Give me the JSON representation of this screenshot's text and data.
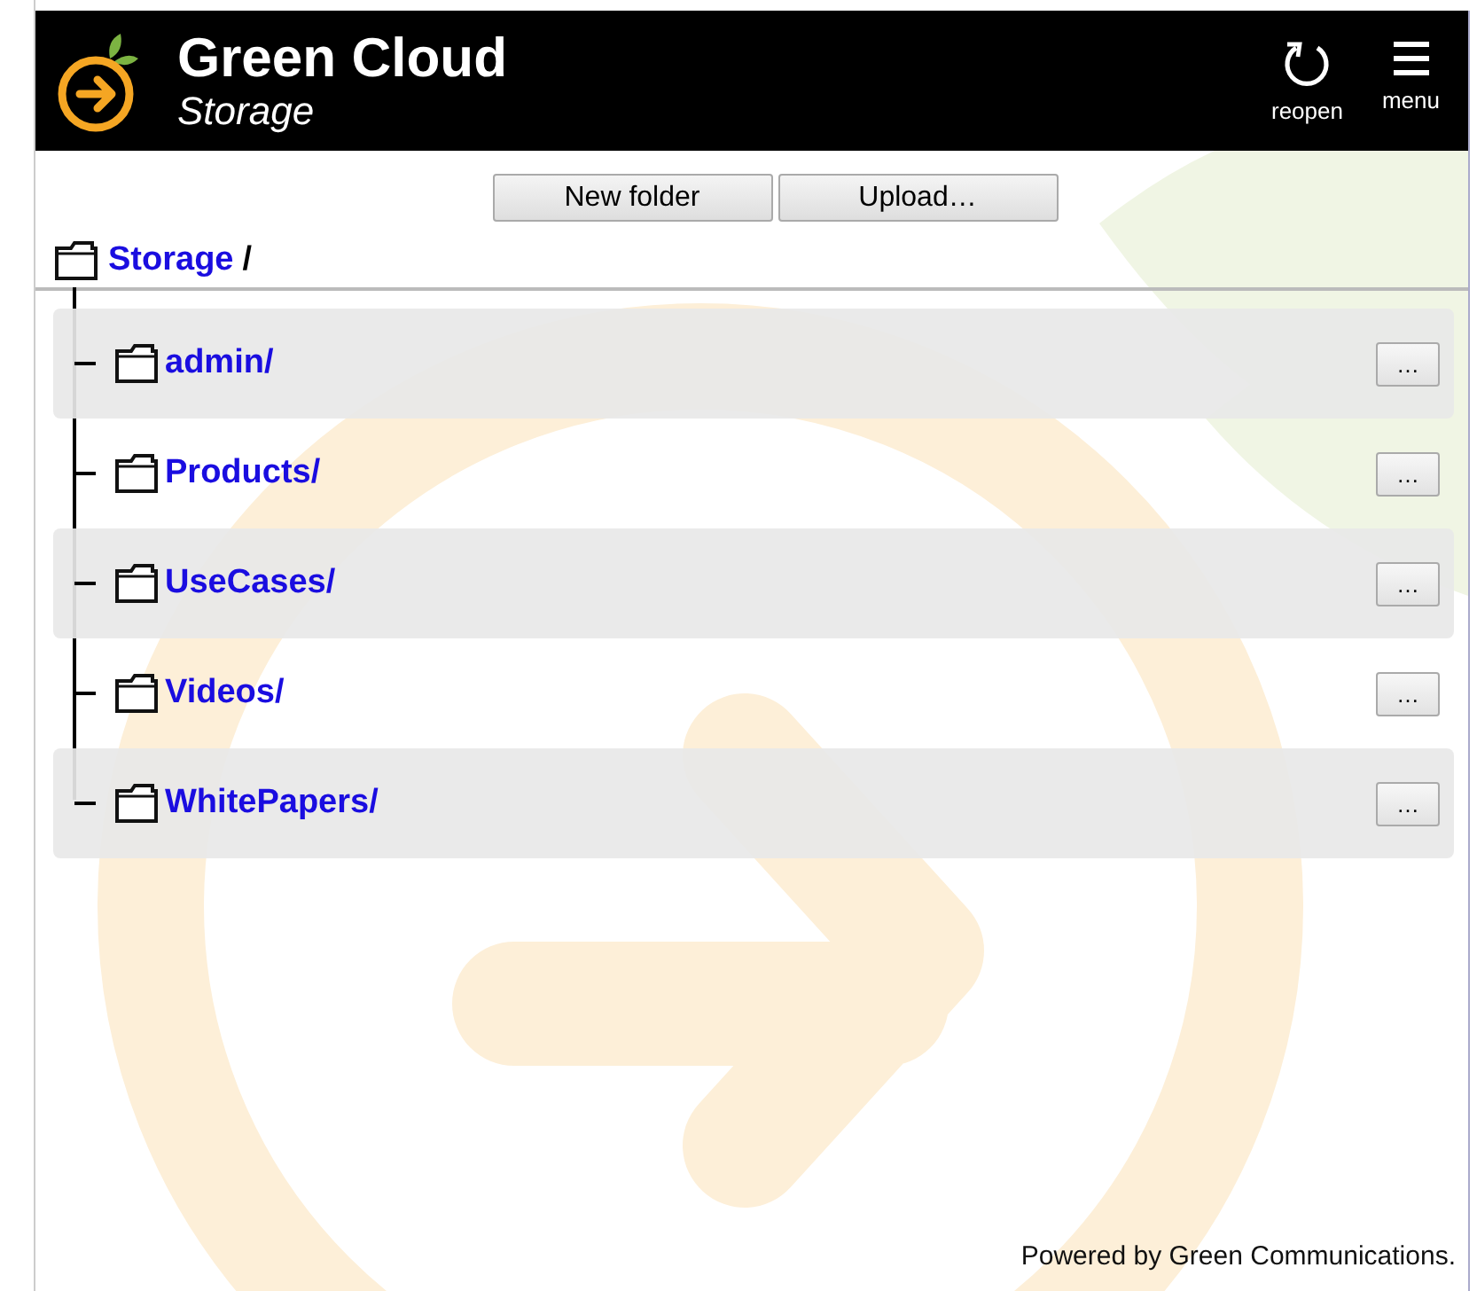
{
  "header": {
    "title": "Green Cloud",
    "subtitle": "Storage",
    "actions": [
      {
        "kind": "reopen",
        "label": "reopen"
      },
      {
        "kind": "menu",
        "label": "menu"
      }
    ]
  },
  "toolbar": {
    "buttons": [
      "New folder",
      "Upload…"
    ]
  },
  "breadcrumb": {
    "link": "Storage",
    "separator": "/"
  },
  "folders": [
    {
      "name": "admin/",
      "action": "…"
    },
    {
      "name": "Products/",
      "action": "…"
    },
    {
      "name": "UseCases/",
      "action": "…"
    },
    {
      "name": "Videos/",
      "action": "…"
    },
    {
      "name": "WhitePapers/",
      "action": "…"
    }
  ],
  "footer": "Powered by Green Communications."
}
